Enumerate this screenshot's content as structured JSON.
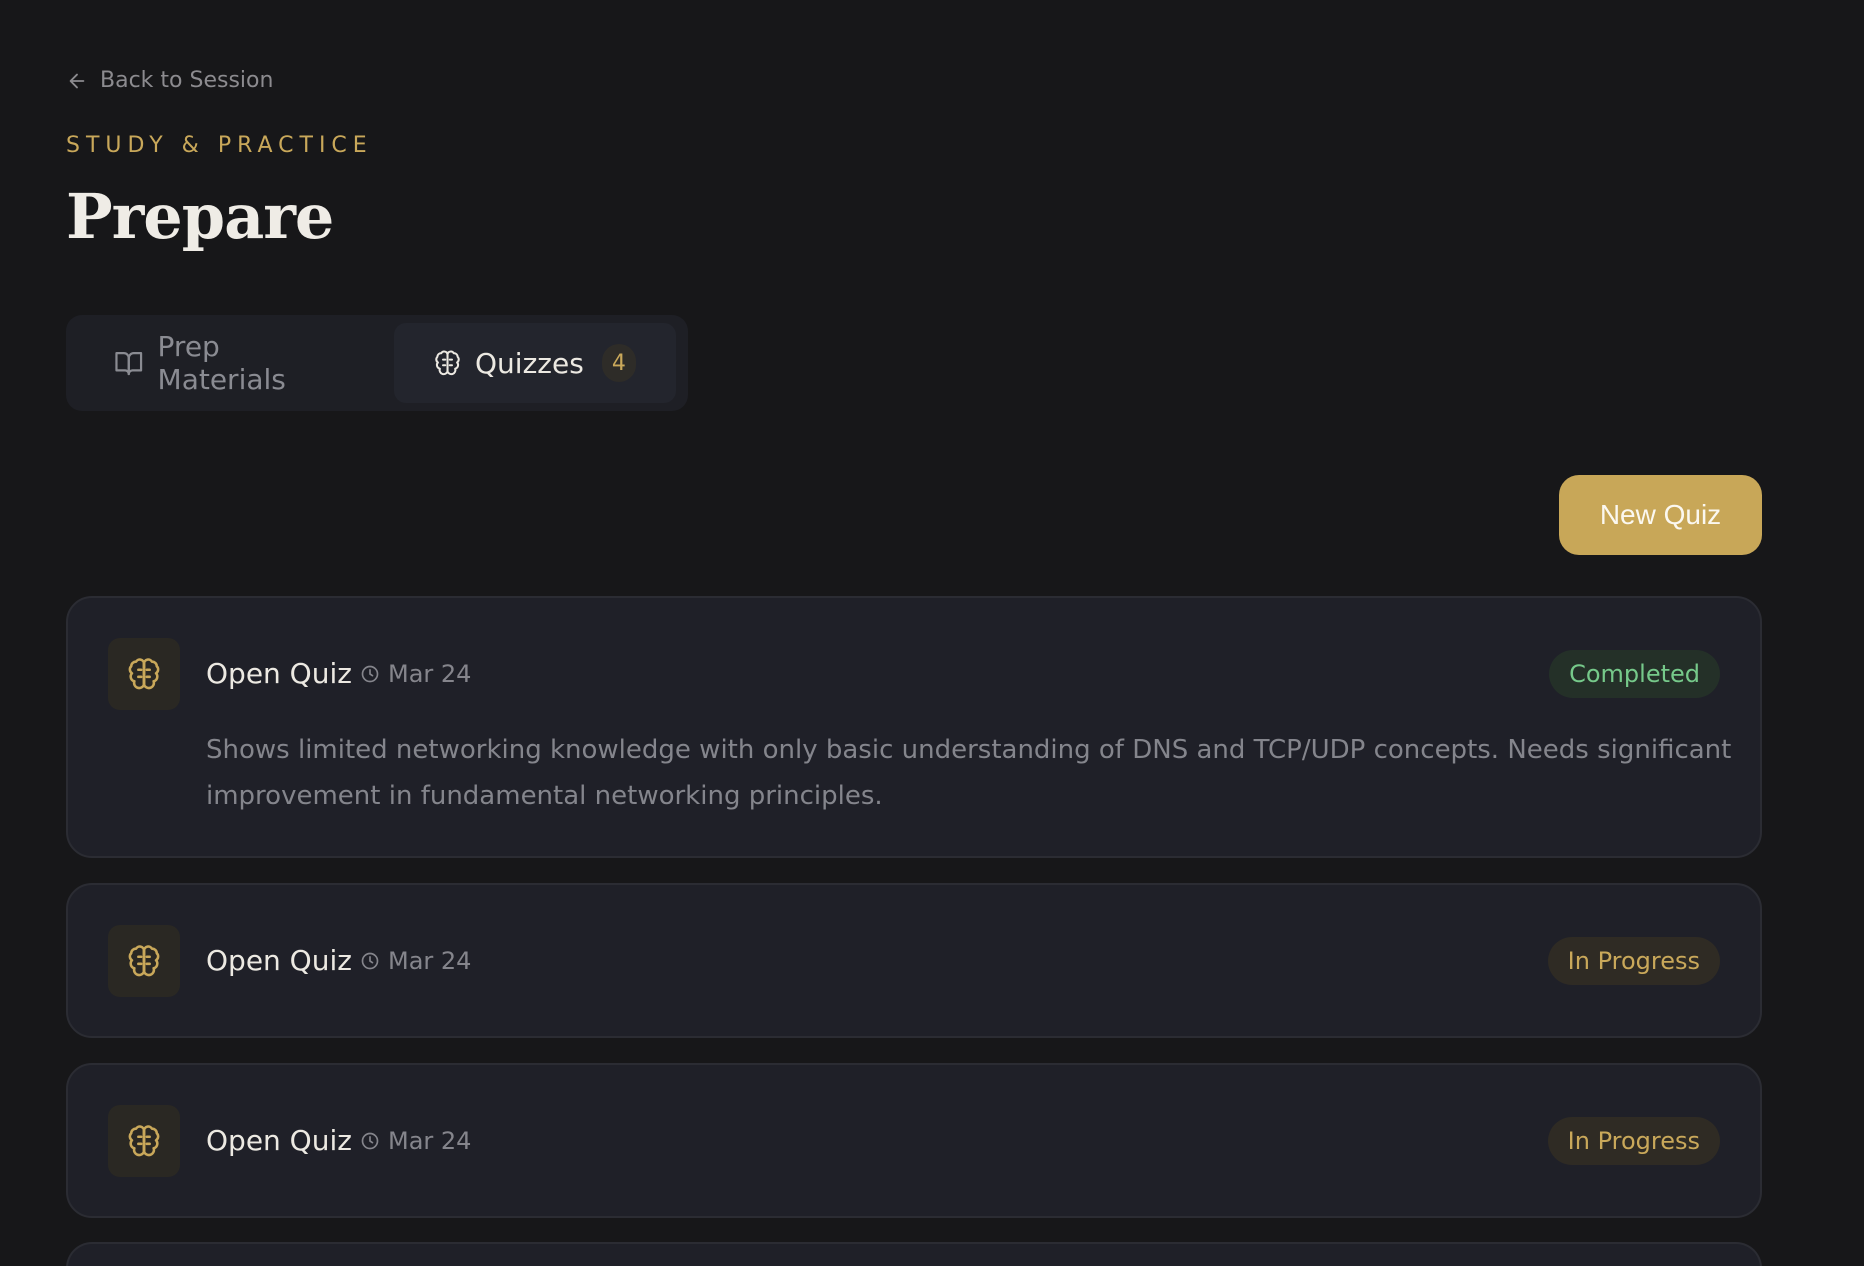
{
  "nav": {
    "back_label": "Back to Session"
  },
  "header": {
    "eyebrow": "STUDY & PRACTICE",
    "title": "Prepare"
  },
  "tabs": [
    {
      "label": "Prep Materials",
      "icon": "book-icon",
      "active": false
    },
    {
      "label": "Quizzes",
      "icon": "brain-icon",
      "active": true,
      "count": "4"
    }
  ],
  "actions": {
    "new_quiz_label": "New Quiz"
  },
  "quizzes": [
    {
      "title": "Open Quiz",
      "date": "Mar 24",
      "status": "Completed",
      "description": "Shows limited networking knowledge with only basic understanding of DNS and TCP/UDP concepts. Needs significant improvement in fundamental networking principles."
    },
    {
      "title": "Open Quiz",
      "date": "Mar 24",
      "status": "In Progress"
    },
    {
      "title": "Open Quiz",
      "date": "Mar 24",
      "status": "In Progress"
    }
  ],
  "colors": {
    "background": "#171719",
    "accent": "#c8a758",
    "card": "#1f2028",
    "completed": "#76c98a",
    "in_progress": "#c9a85a"
  }
}
